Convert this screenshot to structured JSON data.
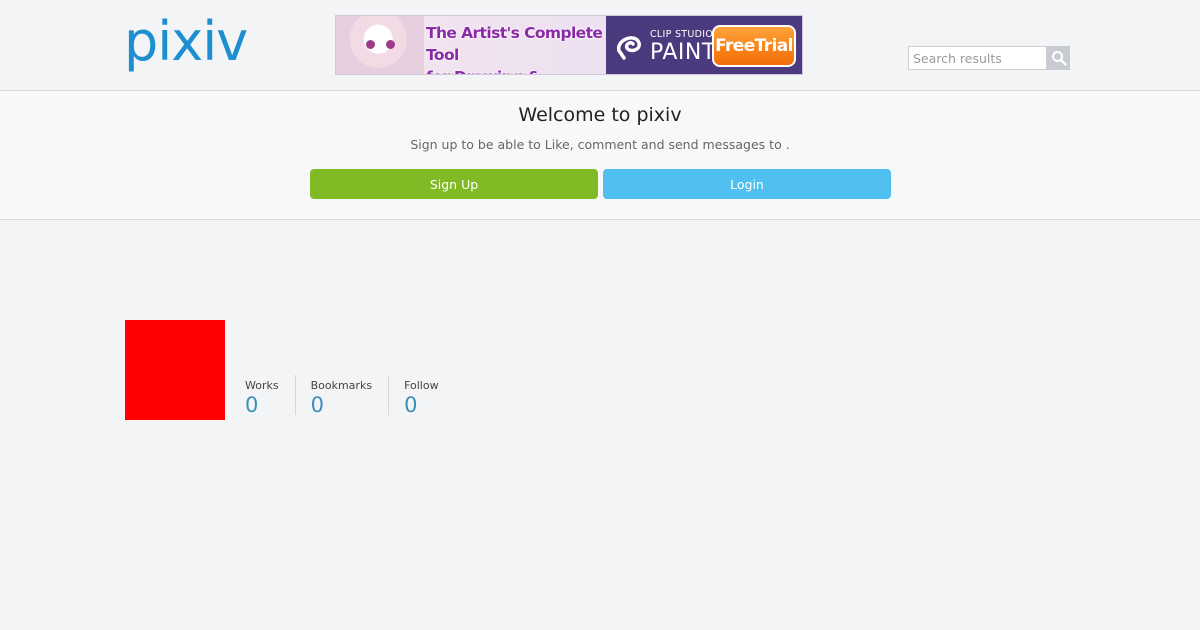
{
  "header": {
    "logo_text": "pixiv",
    "ad": {
      "headline_line1": "The Artist's Complete Tool",
      "headline_line2": "for Drawing & Painting",
      "brand_small": "CLIP STUDIO",
      "brand_big": "PAINT",
      "cta": "FreeTrial"
    },
    "search": {
      "placeholder": "Search results",
      "icon": "search-icon"
    }
  },
  "welcome": {
    "title": "Welcome to pixiv",
    "subtitle": "Sign up to be able to Like, comment and send messages to .",
    "signup_label": "Sign Up",
    "login_label": "Login"
  },
  "profile": {
    "avatar_color": "#ff0000",
    "stats": [
      {
        "label": "Works",
        "value": "0"
      },
      {
        "label": "Bookmarks",
        "value": "0"
      },
      {
        "label": "Follow",
        "value": "0"
      }
    ]
  },
  "colors": {
    "brand": "#1d8fd1",
    "signup": "#80bb25",
    "login": "#4fc0ef",
    "stat_value": "#3d8fb8"
  }
}
